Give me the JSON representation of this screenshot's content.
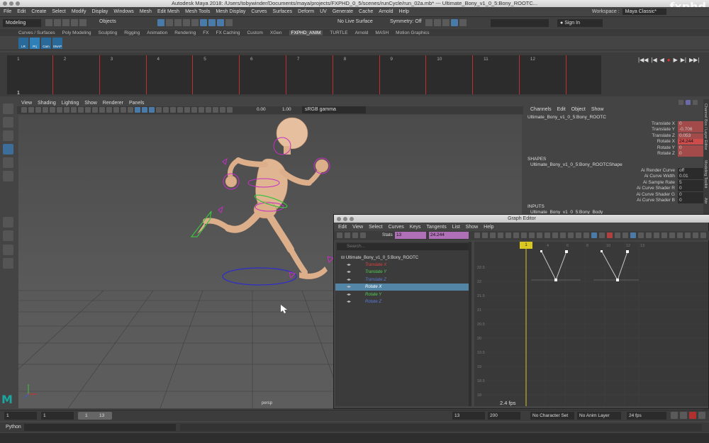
{
  "window": {
    "title": "Autodesk Maya 2018: /Users/tobywinder/Documents/maya/projects/FXPHD_0_5/scenes/runCycle/run_02a.mb*  ---  Ultimate_Bony_v1_0_5:Bony_ROOTC...",
    "watermark": "fxphd"
  },
  "menubar": [
    "File",
    "Edit",
    "Create",
    "Select",
    "Modify",
    "Display",
    "Windows",
    "Mesh",
    "Edit Mesh",
    "Mesh Tools",
    "Mesh Display",
    "Curves",
    "Surfaces",
    "Deform",
    "UV",
    "Generate",
    "Cache",
    "Arnold",
    "Help"
  ],
  "workspace": {
    "label": "Workspace :",
    "value": "Maya Classic*"
  },
  "statusline": {
    "mode": "Modeling",
    "objects": "Objects",
    "live_surface": "No Live Surface",
    "symmetry": "Symmetry: Off",
    "sign_in": "Sign In"
  },
  "shelf_tabs": [
    "Curves / Surfaces",
    "Poly Modeling",
    "Sculpting",
    "Rigging",
    "Animation",
    "Rendering",
    "FX",
    "FX Caching",
    "Custom",
    "XGen",
    "FXPHD_ANIM",
    "TURTLE",
    "Arnold",
    "MASH",
    "Motion Graphics"
  ],
  "shelf_active": "FXPHD_ANIM",
  "shelf_buttons": [
    "LR",
    "Prj",
    "Cam",
    "SNAP"
  ],
  "timeslider": {
    "current_frame": "1",
    "ticks": [
      "1",
      "2",
      "3",
      "4",
      "5",
      "6",
      "7",
      "8",
      "9",
      "10",
      "11",
      "12"
    ]
  },
  "viewport": {
    "menu": [
      "View",
      "Shading",
      "Lighting",
      "Show",
      "Renderer",
      "Panels"
    ],
    "exposure": "0.00",
    "gamma": "1.00",
    "colorspace": "sRGB gamma",
    "camera": "persp"
  },
  "channelbox": {
    "menu": [
      "Channels",
      "Edit",
      "Object",
      "Show"
    ],
    "object": "Ultimate_Bony_v1_0_5:Bony_ROOTC",
    "channels": [
      {
        "name": "Translate X",
        "value": "0"
      },
      {
        "name": "Translate Y",
        "value": "-0.706"
      },
      {
        "name": "Translate Z",
        "value": "0.053"
      },
      {
        "name": "Rotate X",
        "value": "24.244"
      },
      {
        "name": "Rotate Y",
        "value": "0"
      },
      {
        "name": "Rotate Z",
        "value": "0"
      }
    ],
    "shapes_header": "SHAPES",
    "shape_name": "Ultimate_Bony_v1_0_5:Bony_ROOTCShape",
    "shape_attrs": [
      {
        "name": "Ai Render Curve",
        "value": "off"
      },
      {
        "name": "Ai Curve Width",
        "value": "0.01"
      },
      {
        "name": "Ai Sample Rate",
        "value": "5"
      },
      {
        "name": "Ai Curve Shader R",
        "value": "0"
      },
      {
        "name": "Ai Curve Shader G",
        "value": "0"
      },
      {
        "name": "Ai Curve Shader B",
        "value": "0"
      }
    ],
    "inputs_header": "INPUTS",
    "input_name": "Ultimate_Bony_v1_0_5:Bony_Body"
  },
  "right_tabs": [
    "Channel Box / Layer Editor",
    "Modeling Toolkit",
    "Attr"
  ],
  "graph_editor": {
    "title": "Graph Editor",
    "menu": [
      "Edit",
      "View",
      "Select",
      "Curves",
      "Keys",
      "Tangents",
      "List",
      "Show",
      "Help"
    ],
    "stats_label": "Stats",
    "stats_frame": "13",
    "stats_value": "24.244",
    "search_placeholder": "Search...",
    "outliner_root": "Ultimate_Bony_v1_0_5:Bony_ROOTC",
    "channels": [
      {
        "name": "Translate X",
        "color": "#e04040"
      },
      {
        "name": "Translate Y",
        "color": "#50d050"
      },
      {
        "name": "Translate Z",
        "color": "#5a7adc"
      },
      {
        "name": "Rotate X",
        "color": "#ffffff"
      },
      {
        "name": "Rotate Y",
        "color": "#50d050"
      },
      {
        "name": "Rotate Z",
        "color": "#5a7adc"
      }
    ],
    "frame_marks": [
      "1",
      "2",
      "4",
      "6",
      "8",
      "10",
      "12",
      "13"
    ],
    "value_ticks": [
      "22.5",
      "22",
      "21.5",
      "21",
      "20.5",
      "20",
      "19.5",
      "19",
      "18.5",
      "18",
      "17.5"
    ]
  },
  "fps_readout": "2.4 fps",
  "range": {
    "start": "1",
    "playback_start": "1",
    "range_field": "1",
    "range_end": "13",
    "playback_end": "13",
    "anim_end": "200",
    "character_set": "No Character Set",
    "anim_layer": "No Anim Layer",
    "fps": "24 fps"
  },
  "script_language": "Python"
}
